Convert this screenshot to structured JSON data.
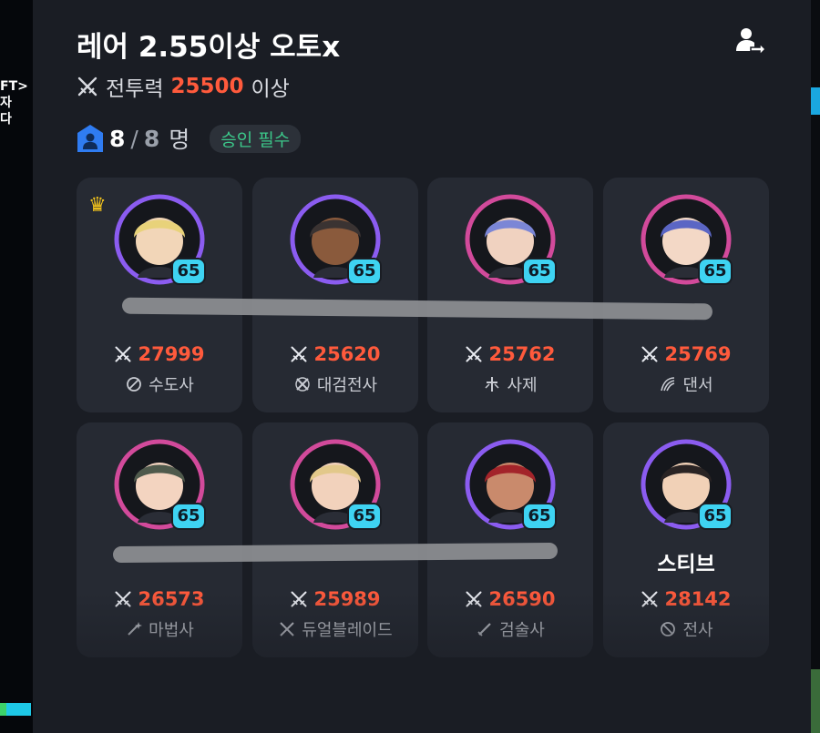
{
  "background": {
    "left_text": [
      "FT>",
      "자",
      "다"
    ]
  },
  "party": {
    "title": "레어 2.55이상 오토x",
    "requirement_label": "전투력",
    "requirement_value": "25500",
    "requirement_suffix": "이상",
    "member_count": "8",
    "member_separator": "/",
    "member_max": "8",
    "member_unit": "명",
    "approval_badge": "승인 필수"
  },
  "colors": {
    "accent_red": "#ff5a3c",
    "level_cyan": "#3ed3f2",
    "approval_green": "#3cc88a",
    "crown_gold": "#f5c51c"
  },
  "members": [
    {
      "name": "",
      "level": "65",
      "power": "27999",
      "job": "수도사",
      "leader": true,
      "ring": "#8b5cf0",
      "job_icon": "monk-icon"
    },
    {
      "name": "",
      "level": "65",
      "power": "25620",
      "job": "대검전사",
      "leader": false,
      "ring": "#8b5cf0",
      "job_icon": "greatsword-icon"
    },
    {
      "name": "",
      "level": "65",
      "power": "25762",
      "job": "사제",
      "leader": false,
      "ring": "#d24a9b",
      "job_icon": "priest-icon"
    },
    {
      "name": "",
      "level": "65",
      "power": "25769",
      "job": "댄서",
      "leader": false,
      "ring": "#d24a9b",
      "job_icon": "dancer-icon"
    },
    {
      "name": "",
      "level": "65",
      "power": "26573",
      "job": "마법사",
      "leader": false,
      "ring": "#d24a9b",
      "job_icon": "wand-icon"
    },
    {
      "name": "",
      "level": "65",
      "power": "25989",
      "job": "듀얼블레이드",
      "leader": false,
      "ring": "#d24a9b",
      "job_icon": "dual-blade-icon"
    },
    {
      "name": "",
      "level": "65",
      "power": "26590",
      "job": "검술사",
      "leader": false,
      "ring": "#8b5cf0",
      "job_icon": "sword-icon"
    },
    {
      "name": "스티브",
      "level": "65",
      "power": "28142",
      "job": "전사",
      "leader": false,
      "ring": "#8b5cf0",
      "job_icon": "warrior-icon"
    }
  ]
}
